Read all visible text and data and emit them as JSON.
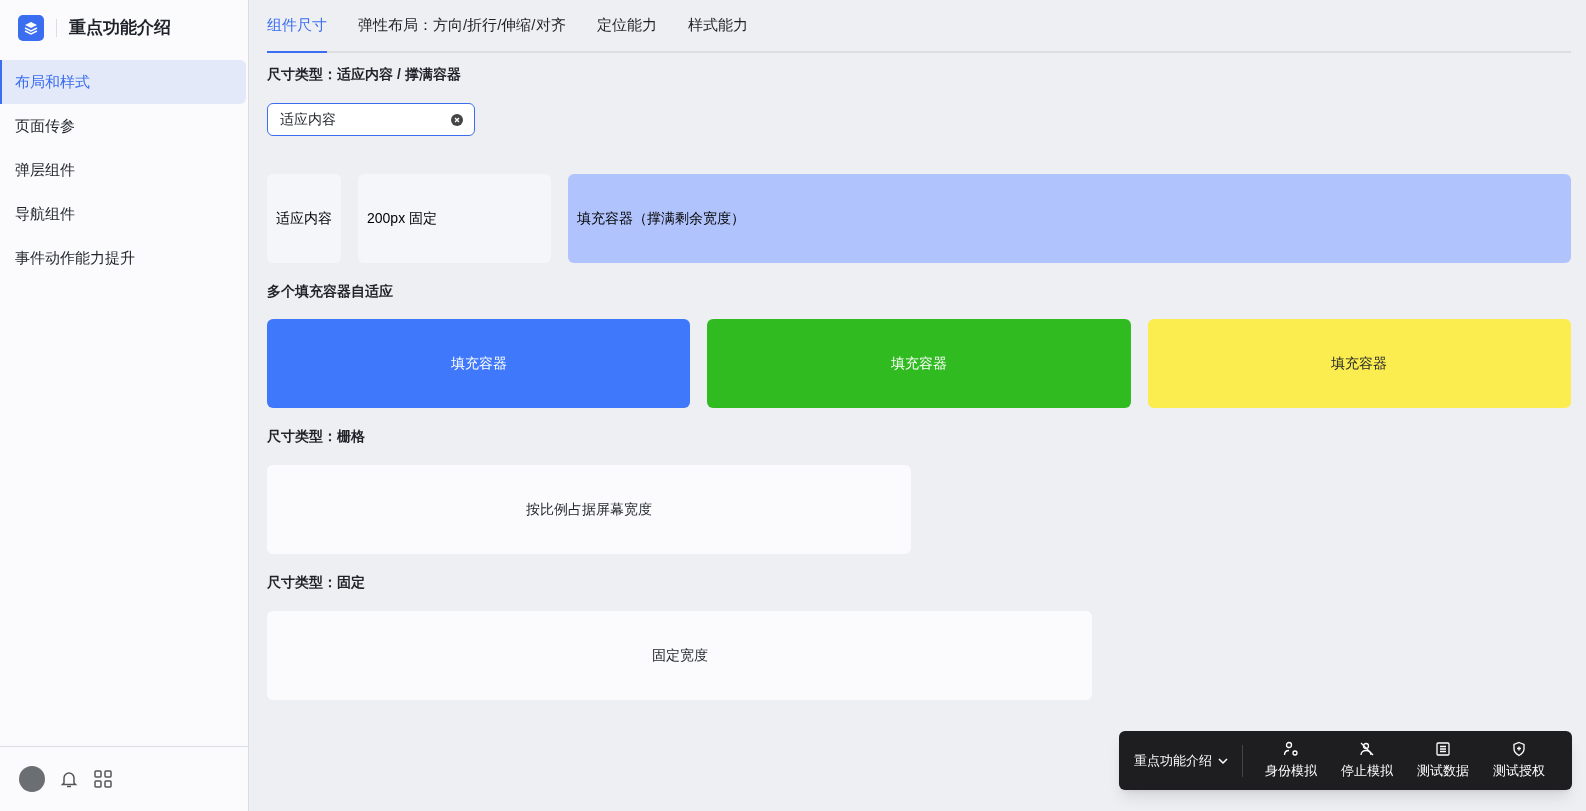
{
  "sidebar": {
    "title": "重点功能介绍",
    "items": [
      {
        "label": "布局和样式",
        "selected": true
      },
      {
        "label": "页面传参",
        "selected": false
      },
      {
        "label": "弹层组件",
        "selected": false
      },
      {
        "label": "导航组件",
        "selected": false
      },
      {
        "label": "事件动作能力提升",
        "selected": false
      }
    ]
  },
  "tabs": [
    {
      "label": "组件尺寸",
      "selected": true
    },
    {
      "label": "弹性布局：方向/折行/伸缩/对齐",
      "selected": false
    },
    {
      "label": "定位能力",
      "selected": false
    },
    {
      "label": "样式能力",
      "selected": false
    }
  ],
  "sections": [
    {
      "kind": "adaptive",
      "title": "尺寸类型：适应内容 / 撑满容器",
      "input": {
        "value": "适应内容"
      },
      "cards": [
        {
          "label": "适应内容"
        },
        {
          "label": "200px 固定"
        },
        {
          "label": "填充容器（撑满剩余宽度）"
        }
      ]
    },
    {
      "kind": "fill",
      "title": "多个填充容器自适应",
      "cards": [
        {
          "label": "填充容器",
          "color": "#4078fb"
        },
        {
          "label": "填充容器",
          "color": "#30bc20"
        },
        {
          "label": "填充容器",
          "color": "#fbec4f"
        }
      ]
    },
    {
      "kind": "grid",
      "title": "尺寸类型：栅格",
      "cards": [
        {
          "label": "按比例占据屏幕宽度"
        }
      ]
    },
    {
      "kind": "fixed",
      "title": "尺寸类型：固定",
      "cards": [
        {
          "label": "固定宽度"
        }
      ]
    }
  ],
  "toolbar": {
    "dropdown": "重点功能介绍",
    "buttons": [
      {
        "kind": "user",
        "label": "身份模拟"
      },
      {
        "kind": "user-off",
        "label": "停止模拟"
      },
      {
        "kind": "table",
        "label": "测试数据"
      },
      {
        "kind": "shield",
        "label": "测试授权"
      }
    ]
  }
}
